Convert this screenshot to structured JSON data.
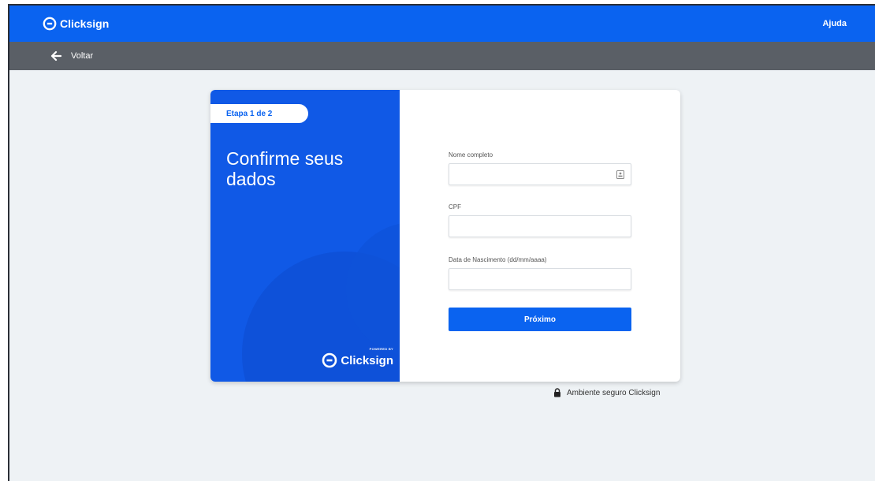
{
  "header": {
    "brand": "Clicksign",
    "help_label": "Ajuda",
    "brand_color": "#0a63f0"
  },
  "subheader": {
    "back_label": "Voltar"
  },
  "card": {
    "step": "Etapa 1 de 2",
    "title": "Confirme seus dados",
    "powered_by": "POWERED BY",
    "powered_brand": "Clicksign"
  },
  "form": {
    "fields": [
      {
        "label": "Nome completo",
        "value": ""
      },
      {
        "label": "CPF",
        "value": ""
      },
      {
        "label": "Data de Nascimento (dd/mm/aaaa)",
        "value": ""
      }
    ],
    "submit_label": "Próximo"
  },
  "footer": {
    "secure_label": "Ambiente seguro Clicksign"
  },
  "icons": [
    "clicksign-logo-icon",
    "back-arrow-icon",
    "contact-card-icon",
    "lock-icon"
  ]
}
